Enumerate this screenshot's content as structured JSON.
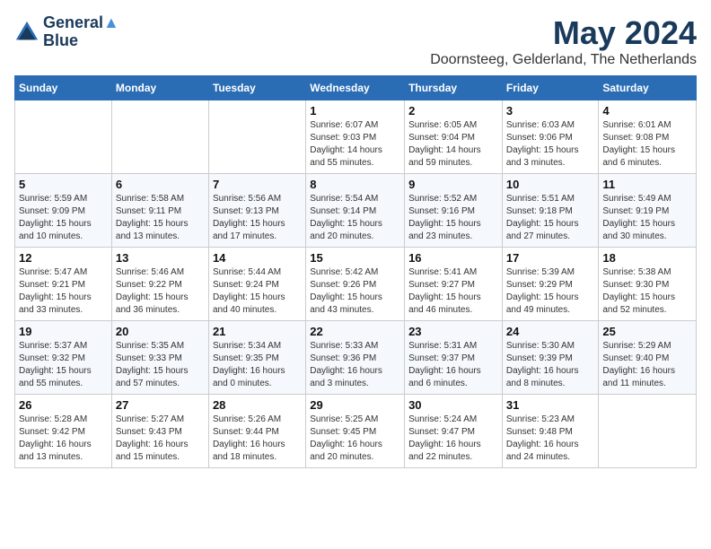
{
  "logo": {
    "line1": "General",
    "line2": "Blue"
  },
  "title": "May 2024",
  "subtitle": "Doornsteeg, Gelderland, The Netherlands",
  "days_of_week": [
    "Sunday",
    "Monday",
    "Tuesday",
    "Wednesday",
    "Thursday",
    "Friday",
    "Saturday"
  ],
  "weeks": [
    [
      {
        "num": "",
        "info": ""
      },
      {
        "num": "",
        "info": ""
      },
      {
        "num": "",
        "info": ""
      },
      {
        "num": "1",
        "info": "Sunrise: 6:07 AM\nSunset: 9:03 PM\nDaylight: 14 hours\nand 55 minutes."
      },
      {
        "num": "2",
        "info": "Sunrise: 6:05 AM\nSunset: 9:04 PM\nDaylight: 14 hours\nand 59 minutes."
      },
      {
        "num": "3",
        "info": "Sunrise: 6:03 AM\nSunset: 9:06 PM\nDaylight: 15 hours\nand 3 minutes."
      },
      {
        "num": "4",
        "info": "Sunrise: 6:01 AM\nSunset: 9:08 PM\nDaylight: 15 hours\nand 6 minutes."
      }
    ],
    [
      {
        "num": "5",
        "info": "Sunrise: 5:59 AM\nSunset: 9:09 PM\nDaylight: 15 hours\nand 10 minutes."
      },
      {
        "num": "6",
        "info": "Sunrise: 5:58 AM\nSunset: 9:11 PM\nDaylight: 15 hours\nand 13 minutes."
      },
      {
        "num": "7",
        "info": "Sunrise: 5:56 AM\nSunset: 9:13 PM\nDaylight: 15 hours\nand 17 minutes."
      },
      {
        "num": "8",
        "info": "Sunrise: 5:54 AM\nSunset: 9:14 PM\nDaylight: 15 hours\nand 20 minutes."
      },
      {
        "num": "9",
        "info": "Sunrise: 5:52 AM\nSunset: 9:16 PM\nDaylight: 15 hours\nand 23 minutes."
      },
      {
        "num": "10",
        "info": "Sunrise: 5:51 AM\nSunset: 9:18 PM\nDaylight: 15 hours\nand 27 minutes."
      },
      {
        "num": "11",
        "info": "Sunrise: 5:49 AM\nSunset: 9:19 PM\nDaylight: 15 hours\nand 30 minutes."
      }
    ],
    [
      {
        "num": "12",
        "info": "Sunrise: 5:47 AM\nSunset: 9:21 PM\nDaylight: 15 hours\nand 33 minutes."
      },
      {
        "num": "13",
        "info": "Sunrise: 5:46 AM\nSunset: 9:22 PM\nDaylight: 15 hours\nand 36 minutes."
      },
      {
        "num": "14",
        "info": "Sunrise: 5:44 AM\nSunset: 9:24 PM\nDaylight: 15 hours\nand 40 minutes."
      },
      {
        "num": "15",
        "info": "Sunrise: 5:42 AM\nSunset: 9:26 PM\nDaylight: 15 hours\nand 43 minutes."
      },
      {
        "num": "16",
        "info": "Sunrise: 5:41 AM\nSunset: 9:27 PM\nDaylight: 15 hours\nand 46 minutes."
      },
      {
        "num": "17",
        "info": "Sunrise: 5:39 AM\nSunset: 9:29 PM\nDaylight: 15 hours\nand 49 minutes."
      },
      {
        "num": "18",
        "info": "Sunrise: 5:38 AM\nSunset: 9:30 PM\nDaylight: 15 hours\nand 52 minutes."
      }
    ],
    [
      {
        "num": "19",
        "info": "Sunrise: 5:37 AM\nSunset: 9:32 PM\nDaylight: 15 hours\nand 55 minutes."
      },
      {
        "num": "20",
        "info": "Sunrise: 5:35 AM\nSunset: 9:33 PM\nDaylight: 15 hours\nand 57 minutes."
      },
      {
        "num": "21",
        "info": "Sunrise: 5:34 AM\nSunset: 9:35 PM\nDaylight: 16 hours\nand 0 minutes."
      },
      {
        "num": "22",
        "info": "Sunrise: 5:33 AM\nSunset: 9:36 PM\nDaylight: 16 hours\nand 3 minutes."
      },
      {
        "num": "23",
        "info": "Sunrise: 5:31 AM\nSunset: 9:37 PM\nDaylight: 16 hours\nand 6 minutes."
      },
      {
        "num": "24",
        "info": "Sunrise: 5:30 AM\nSunset: 9:39 PM\nDaylight: 16 hours\nand 8 minutes."
      },
      {
        "num": "25",
        "info": "Sunrise: 5:29 AM\nSunset: 9:40 PM\nDaylight: 16 hours\nand 11 minutes."
      }
    ],
    [
      {
        "num": "26",
        "info": "Sunrise: 5:28 AM\nSunset: 9:42 PM\nDaylight: 16 hours\nand 13 minutes."
      },
      {
        "num": "27",
        "info": "Sunrise: 5:27 AM\nSunset: 9:43 PM\nDaylight: 16 hours\nand 15 minutes."
      },
      {
        "num": "28",
        "info": "Sunrise: 5:26 AM\nSunset: 9:44 PM\nDaylight: 16 hours\nand 18 minutes."
      },
      {
        "num": "29",
        "info": "Sunrise: 5:25 AM\nSunset: 9:45 PM\nDaylight: 16 hours\nand 20 minutes."
      },
      {
        "num": "30",
        "info": "Sunrise: 5:24 AM\nSunset: 9:47 PM\nDaylight: 16 hours\nand 22 minutes."
      },
      {
        "num": "31",
        "info": "Sunrise: 5:23 AM\nSunset: 9:48 PM\nDaylight: 16 hours\nand 24 minutes."
      },
      {
        "num": "",
        "info": ""
      }
    ]
  ]
}
